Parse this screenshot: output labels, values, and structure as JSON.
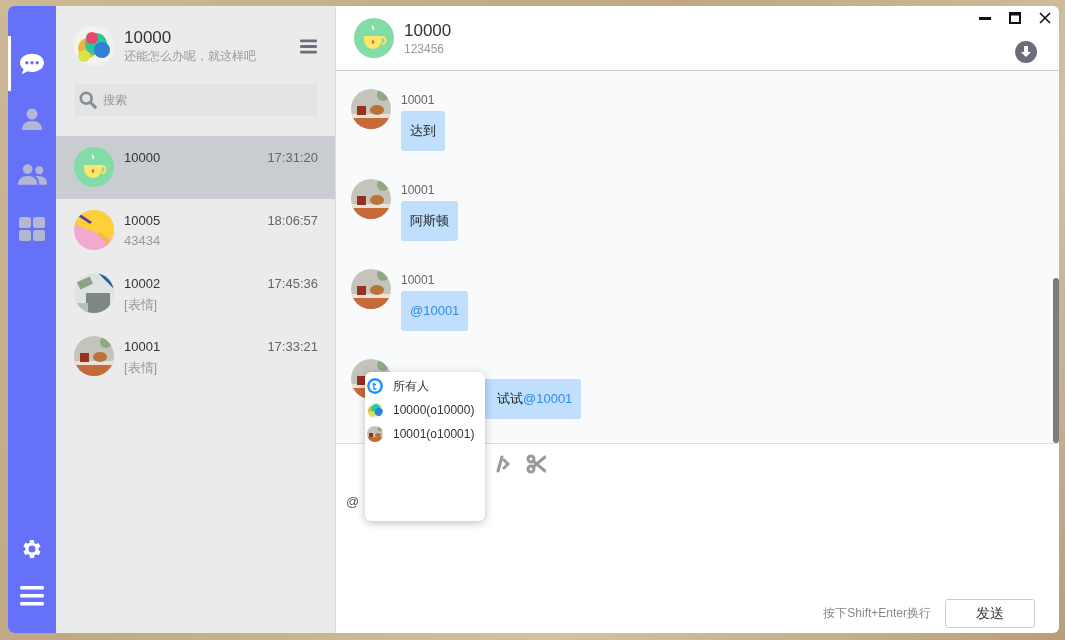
{
  "nav": {
    "items": [
      {
        "selected": true
      },
      {
        "selected": false
      },
      {
        "selected": false
      },
      {
        "selected": false
      }
    ]
  },
  "profile": {
    "name": "10000",
    "signature": "还能怎么办呢，就这样吧"
  },
  "search": {
    "placeholder": "搜索"
  },
  "conversations": [
    {
      "name": "10000",
      "time": "17:31:20",
      "selected": true
    },
    {
      "name": "10005",
      "time": "18:06:57",
      "preview": "43434",
      "selected": false
    },
    {
      "name": "10002",
      "time": "17:45:36",
      "preview": "[表情]",
      "selected": false
    },
    {
      "name": "10001",
      "time": "17:33:21",
      "preview": "[表情]",
      "selected": false
    }
  ],
  "chat": {
    "title": "10000",
    "subtitle": "123456"
  },
  "messages": [
    {
      "sender": "10001",
      "parts": [
        {
          "kind": "text",
          "text": "达到"
        }
      ]
    },
    {
      "sender": "10001",
      "parts": [
        {
          "kind": "text",
          "text": "阿斯顿"
        }
      ]
    },
    {
      "sender": "10001",
      "parts": [
        {
          "kind": "mention",
          "text": "@10001"
        }
      ]
    },
    {
      "parts": [
        {
          "kind": "text",
          "text": "试试"
        },
        {
          "kind": "mention",
          "text": "@10001"
        }
      ]
    }
  ],
  "mention_popup": {
    "items": [
      {
        "label": "所有人"
      },
      {
        "label": "10000(o10000)"
      },
      {
        "label": "10001(o10001)"
      }
    ]
  },
  "composer": {
    "value": "@",
    "hint": "按下Shift+Enter换行",
    "send": "发送"
  }
}
